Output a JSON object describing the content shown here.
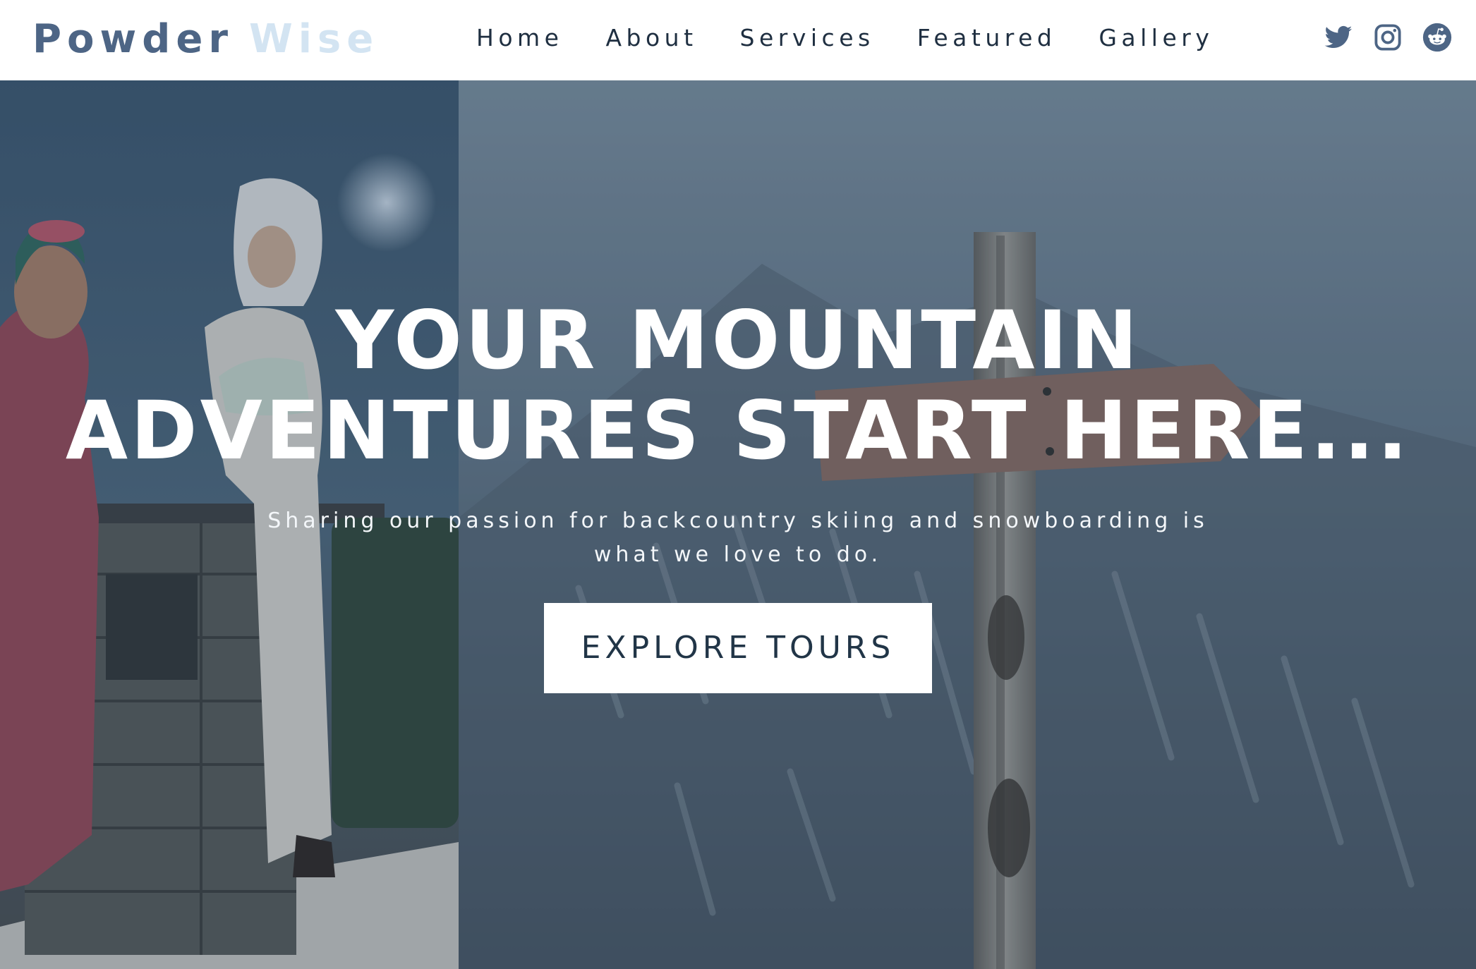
{
  "brand": {
    "word1": "Powder",
    "word2": "Wise",
    "word1_color": "#4d6585",
    "word2_color": "#d3e4f2"
  },
  "nav": {
    "items": [
      {
        "label": "Home"
      },
      {
        "label": "About"
      },
      {
        "label": "Services"
      },
      {
        "label": "Featured"
      },
      {
        "label": "Gallery"
      }
    ]
  },
  "social": [
    {
      "icon": "twitter-icon"
    },
    {
      "icon": "instagram-icon"
    },
    {
      "icon": "reddit-icon"
    }
  ],
  "hero": {
    "title_line1": "YOUR MOUNTAIN",
    "title_line2": "ADVENTURES START HERE...",
    "subtitle": "Sharing our passion for backcountry skiing and snowboarding is what we love to do.",
    "cta_label": "EXPLORE TOURS",
    "image_left": "people-at-outdoor-bar-in-snow-photo",
    "image_right": "wooden-signpost-arrow-snowy-mountain-photo"
  },
  "colors": {
    "nav_text": "#1f2f41",
    "icon": "#4d6585",
    "cta_text": "#213547",
    "hero_overlay": "#2c4056"
  }
}
